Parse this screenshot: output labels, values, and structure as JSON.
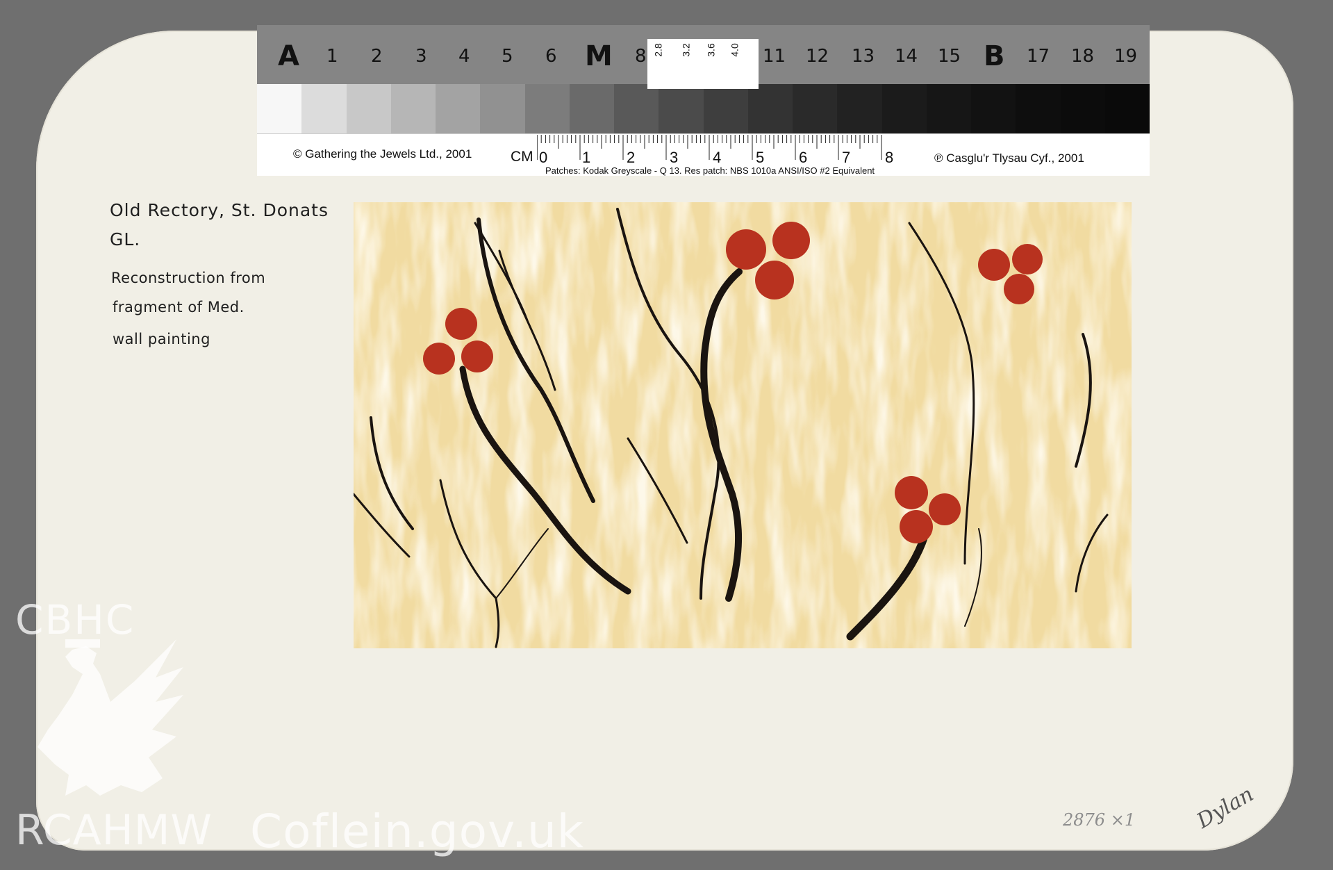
{
  "card": {
    "title_line1": "Old Rectory, St. Donats",
    "title_line2": "GL.",
    "desc_lines": [
      "Reconstruction from",
      "fragment of Med.",
      "wall painting"
    ]
  },
  "target": {
    "top_labels": [
      "A",
      "1",
      "2",
      "3",
      "4",
      "5",
      "6",
      "M",
      "8",
      "11",
      "12",
      "13",
      "14",
      "15",
      "B",
      "17",
      "18",
      "19"
    ],
    "res_labels": [
      "2.8",
      "3.2",
      "3.6",
      "4.0"
    ],
    "copyright_left": "© Gathering the Jewels Ltd., 2001",
    "copyright_right": "℗ Casglu'r Tlysau Cyf., 2001",
    "cm_label": "CM",
    "cm_numbers": [
      "0",
      "1",
      "2",
      "3",
      "4",
      "5",
      "6",
      "7",
      "8"
    ],
    "patches_note": "Patches: Kodak Greyscale - Q 13.  Res patch: NBS 1010a ANSI/ISO #2 Equivalent"
  },
  "watermark": {
    "cbhc": "CBHC",
    "rcahmw": "RCAHMW",
    "coflein": "Coflein.gov.uk"
  },
  "handwriting": {
    "ref": "2876 ×1",
    "signature": "Dylan"
  },
  "colors": {
    "board": "#f1efe6",
    "painting_ground": "#f0dea6",
    "berry": "#b8321f",
    "stem": "#1a1410"
  }
}
